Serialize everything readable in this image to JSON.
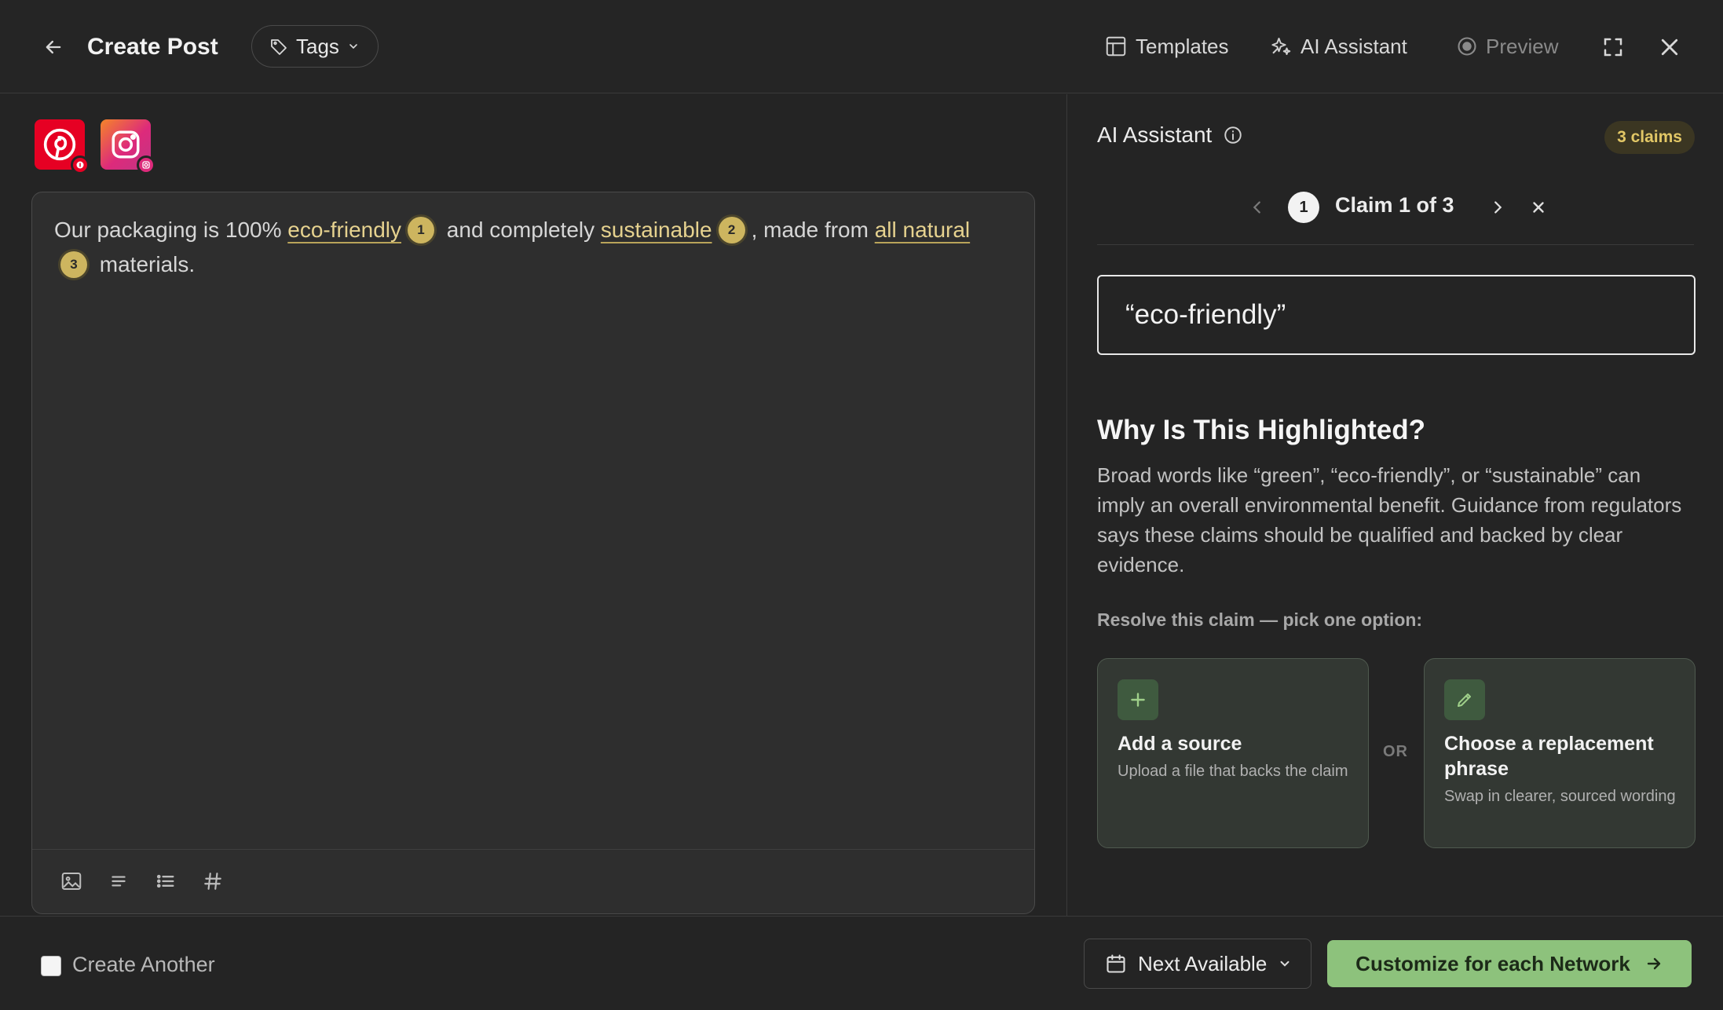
{
  "header": {
    "title": "Create Post",
    "tags_label": "Tags",
    "templates_label": "Templates",
    "ai_assistant_label": "AI Assistant",
    "preview_label": "Preview"
  },
  "networks": [
    {
      "name": "Pinterest",
      "color": "#e60023",
      "icon": "pinterest-icon"
    },
    {
      "name": "Instagram",
      "color": "#e4405f",
      "icon": "instagram-icon"
    }
  ],
  "editor": {
    "segments": {
      "t1": "Our packaging is 100% ",
      "h1": "eco-friendly",
      "n1": "1",
      "t2": " and completely ",
      "h2": "sustainable",
      "n2": "2",
      "t3": ", made from ",
      "h3": "all natural",
      "n3": "3",
      "t4": " materials."
    }
  },
  "ai_panel": {
    "title": "AI Assistant",
    "claims_count": "3 claims",
    "claim_number": "1",
    "claim_label": "Claim 1 of 3",
    "quote": "“eco-friendly”",
    "why_title": "Why Is This Highlighted?",
    "why_text": "Broad words like “green”, “eco-friendly”, or “sustainable” can imply an overall environmental benefit. Guidance from regulators says these claims should be qualified and backed by clear evidence.",
    "resolve_label": "Resolve this claim — pick one option:",
    "or_label": "OR",
    "options": [
      {
        "title": "Add a source",
        "desc": "Upload a file that backs the claim",
        "icon": "plus-icon"
      },
      {
        "title": "Choose a replacement phrase",
        "desc": "Swap in clearer, sourced wording",
        "icon": "pencil-icon"
      }
    ]
  },
  "footer": {
    "create_another_label": "Create Another",
    "create_another_checked": false,
    "schedule_label": "Next Available",
    "primary_label": "Customize for each Network"
  },
  "colors": {
    "highlight": "#e6d28f",
    "claim_badge": "#cdb55f",
    "primary": "#8dc27c"
  }
}
